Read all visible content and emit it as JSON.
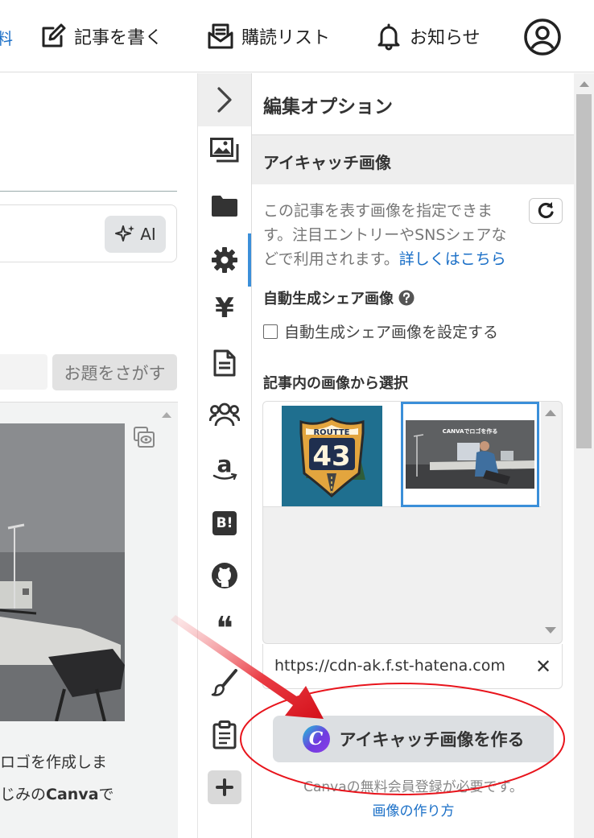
{
  "header": {
    "cut_text": "料",
    "write_label": "記事を書く",
    "subscriptions_label": "購読リスト",
    "notifications_label": "お知らせ"
  },
  "editor": {
    "ai_button_label": "AI",
    "topic_button_label": "お題をさがす",
    "body_line1": "ロゴを作成しま",
    "body_line2_prefix": "じみの",
    "body_line2_bold": "Canva",
    "body_line2_suffix": "で"
  },
  "rail": {
    "icons": [
      "chevron-right-icon",
      "image-icon",
      "folder-icon",
      "gear-icon",
      "yen-icon",
      "document-icon",
      "users-icon",
      "amazon-icon",
      "hatena-bookmark-icon",
      "github-icon",
      "quote-icon",
      "brush-icon",
      "clipboard-icon",
      "plus-icon"
    ],
    "bookmark_text": "B!",
    "amazon_text": "a",
    "yen_text": "¥",
    "quote_text": "❝"
  },
  "panel": {
    "title": "編集オプション",
    "section_title": "アイキャッチ画像",
    "description_line1": "この記事を表す画像を指定できま",
    "description_line2": "す。注目エントリーやSNSシェアな",
    "description_line3": "どで利用されます。",
    "learn_more_link": "詳しくはこちら",
    "autogen_label": "自動生成シェア画像",
    "autogen_checkbox_label": "自動生成シェア画像を設定する",
    "autogen_checked": false,
    "pick_label": "記事内の画像から選択",
    "thumb1_text_top": "ROUTTE",
    "thumb1_text_number": "43",
    "thumb2_caption": "CANVAでロゴを作る",
    "url_value": "https://cdn-ak.f.st-hatena.com",
    "clear_symbol": "✕",
    "make_button_label": "アイキャッチ画像を作る",
    "canva_letter": "C",
    "note": "Canvaの無料会員登録が必要です。",
    "howto_link": "画像の作り方"
  },
  "colors": {
    "accent": "#3b8fd9",
    "link": "#1a6fc7",
    "annotation": "#e8141c"
  }
}
